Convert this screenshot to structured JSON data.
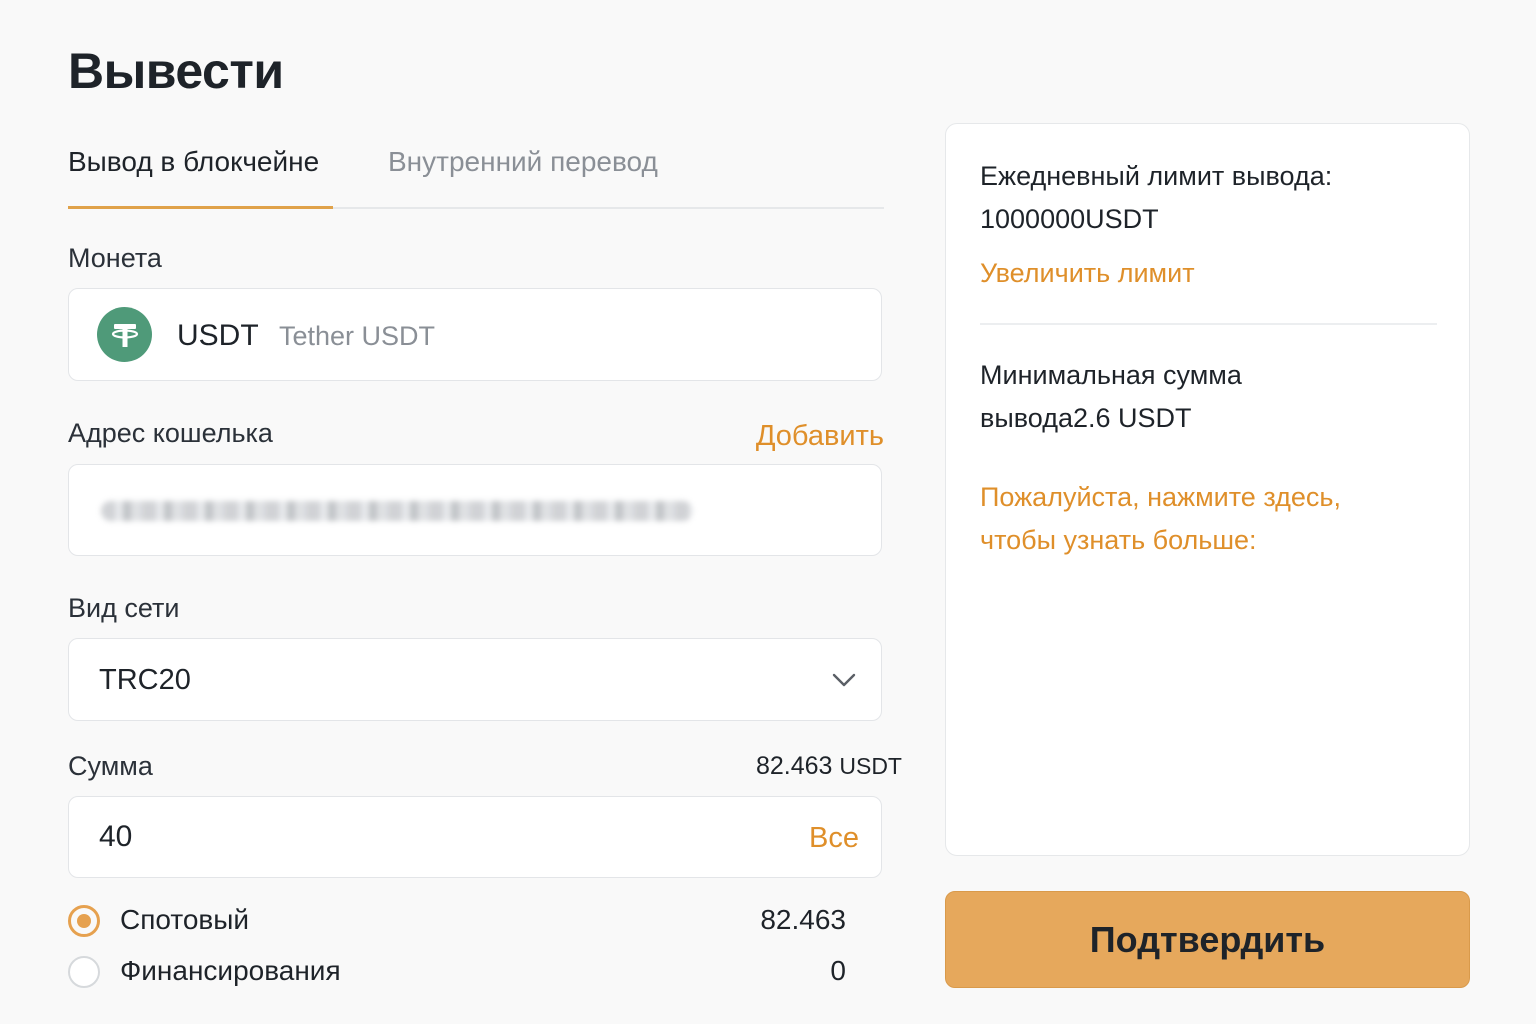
{
  "page": {
    "title": "Вывести"
  },
  "tabs": [
    {
      "label": "Вывод в блокчейне",
      "active": true
    },
    {
      "label": "Внутренний перевод",
      "active": false
    }
  ],
  "coin": {
    "label": "Монета",
    "symbol": "USDT",
    "name": "Tether USDT",
    "icon": "tether-icon",
    "icon_color": "#4f9a79"
  },
  "address": {
    "label": "Адрес кошелька",
    "add_link": "Добавить",
    "value_state": "blurred"
  },
  "network": {
    "label": "Вид сети",
    "selected": "TRC20",
    "icon": "chevron-down-icon"
  },
  "amount": {
    "label": "Сумма",
    "available_value": "82.463",
    "available_unit": "USDT",
    "value": "40",
    "all_link": "Все"
  },
  "accounts": [
    {
      "label": "Спотовый",
      "value": "82.463",
      "selected": true
    },
    {
      "label": "Финансирования",
      "value": "0",
      "selected": false
    }
  ],
  "side": {
    "daily_limit_line1": "Ежедневный лимит вывода:",
    "daily_limit_line2": "1000000USDT",
    "increase_link": "Увеличить лимит",
    "min_line1": "Минимальная сумма",
    "min_line2": "вывода2.6 USDT",
    "more_line1": "Пожалуйста, нажмите здесь,",
    "more_line2": "чтобы узнать больше:"
  },
  "confirm_button": "Подтвердить",
  "colors": {
    "accent": "#df8f2a",
    "button": "#e6a85c",
    "tab_underline": "#e0a24a",
    "text": "#1e2329",
    "muted": "#8a8f96"
  }
}
